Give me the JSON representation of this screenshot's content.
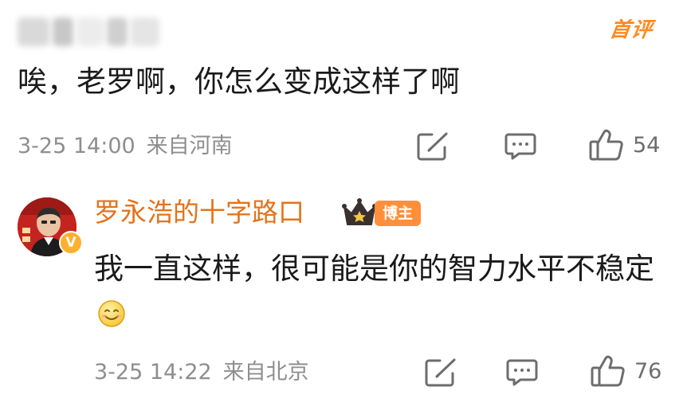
{
  "comment": {
    "text": "唉，老罗啊，你怎么变成这样了啊",
    "first_badge": "首评",
    "time": "3-25 14:00",
    "location": "来自河南",
    "likes": "54"
  },
  "reply": {
    "author": "罗永浩的十字路口",
    "verified_mark": "V",
    "role_badge": "博主",
    "text": "我一直这样，很可能是你的智力水平不稳定",
    "time": "3-25 14:22",
    "location": "来自北京",
    "likes": "76"
  },
  "colors": {
    "author_name": "#e3731b",
    "role_badge": "#ff8f3a",
    "first_badge": "#ff8a1e",
    "meta": "#8e8e8e",
    "verified": "#ffb02e"
  },
  "icons": {
    "share": "share-icon",
    "comment": "comment-icon",
    "like": "thumbs-up-icon",
    "crown": "crown-icon",
    "emoji": "smile-emoji"
  }
}
